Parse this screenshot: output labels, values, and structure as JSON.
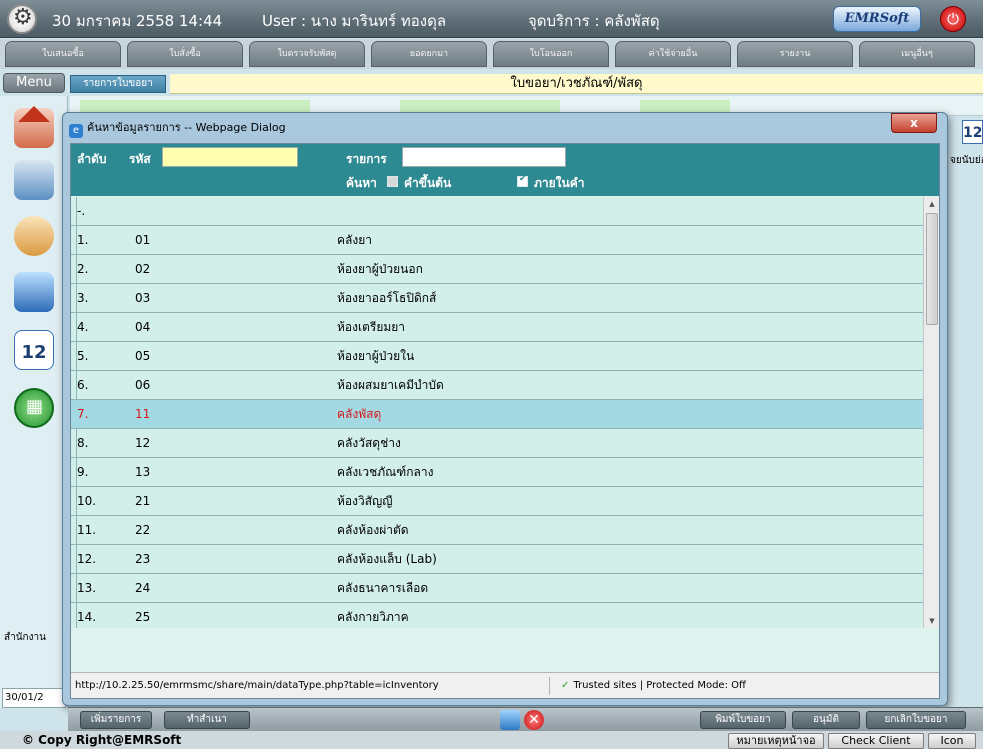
{
  "topbar": {
    "datetime": "30 มกราคม 2558 14:44",
    "user": "User : นาง มารินทร์ ทองดุล",
    "service_point": "จุดบริการ : คลังพัสดุ",
    "brand": "EMRSoft"
  },
  "tabs": [
    "ใบเสนอซื้อ",
    "ใบสั่งซื้อ",
    "ใบตรวจรับพัสดุ",
    "ยอดยกมา",
    "ใบโอนออก",
    "ค่าใช้จ่ายอื่น",
    "รายงาน",
    "เมนูอื่นๆ"
  ],
  "nav": {
    "menu_label": "Menu",
    "calendar_day": "12",
    "office_label": "สำนักงาน",
    "date_value": "30/01/2"
  },
  "page": {
    "subtab": "รายการใบขอยา",
    "title": "ใบขอยา/เวชภัณฑ์/พัสดุ",
    "calendar_day": "12",
    "side_text": "จยนับย่อ"
  },
  "dialog": {
    "title": "ค้นหาข้อมูลรายการ -- Webpage Dialog",
    "close_label": "x",
    "order_label": "ลำดับ",
    "code_label": "รหัส",
    "code_value": "",
    "item_label": "รายการ",
    "item_value": "",
    "search_label": "ค้นหา",
    "opt_startswith": "คำขึ้นต้น",
    "opt_contains": "ภายในคำ",
    "opt_startswith_checked": false,
    "opt_contains_checked": true,
    "rows": [
      {
        "no": "-.",
        "code": "",
        "name": ""
      },
      {
        "no": "1.",
        "code": "01",
        "name": "คลังยา"
      },
      {
        "no": "2.",
        "code": "02",
        "name": "ห้องยาผู้ป่วยนอก"
      },
      {
        "no": "3.",
        "code": "03",
        "name": "ห้องยาออร์โธปิดิกส์"
      },
      {
        "no": "4.",
        "code": "04",
        "name": "ห้องเตรียมยา"
      },
      {
        "no": "5.",
        "code": "05",
        "name": "ห้องยาผู้ป่วยใน"
      },
      {
        "no": "6.",
        "code": "06",
        "name": "ห้องผสมยาเคมีบำบัด"
      },
      {
        "no": "7.",
        "code": "11",
        "name": "คลังพัสดุ"
      },
      {
        "no": "8.",
        "code": "12",
        "name": "คลังวัสดุช่าง"
      },
      {
        "no": "9.",
        "code": "13",
        "name": "คลังเวชภัณฑ์กลาง"
      },
      {
        "no": "10.",
        "code": "21",
        "name": "ห้องวิสัญญี"
      },
      {
        "no": "11.",
        "code": "22",
        "name": "คลังห้องผ่าตัด"
      },
      {
        "no": "12.",
        "code": "23",
        "name": "คลังห้องแล็บ (Lab)"
      },
      {
        "no": "13.",
        "code": "24",
        "name": "คลังธนาคารเลือด"
      },
      {
        "no": "14.",
        "code": "25",
        "name": "คลังกายวิภาค"
      }
    ],
    "selected_row": 7,
    "status_url": "http://10.2.25.50/emrmsmc/share/main/dataType.php?table=icInventory",
    "status_zone": "Trusted sites | Protected Mode: Off"
  },
  "bottom": {
    "add_item": "เพิ่มรายการ",
    "draft": "ทำสำเนา",
    "print": "พิมพ์ใบขอยา",
    "approve": "อนุมัติ",
    "cancel_request": "ยกเลิกใบขอยา"
  },
  "footer": {
    "copyright": "© Copy Right@EMRSoft",
    "btn1": "หมายเหตุหน้าจอ",
    "btn2": "Check Client",
    "btn3": "Icon"
  }
}
